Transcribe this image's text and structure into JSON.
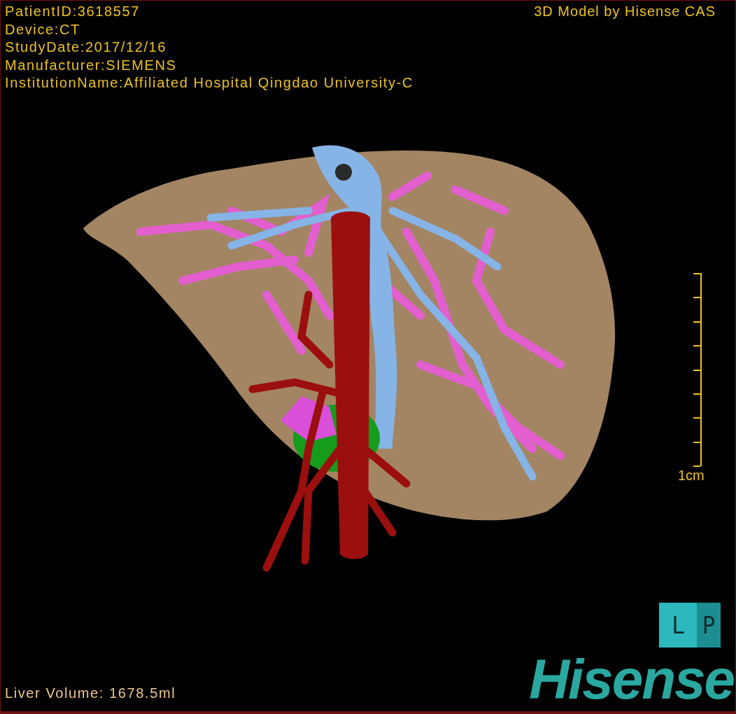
{
  "patient_info": [
    "PatientID:3618557",
    "Device:CT",
    "StudyDate:2017/12/16",
    "Manufacturer:SIEMENS",
    "InstitutionName:Affiliated Hospital Qingdao University-C"
  ],
  "credit": "3D Model by Hisense CAS",
  "scale_bar": {
    "label": "1cm"
  },
  "orientation_cube": {
    "faces": [
      "L",
      "P"
    ]
  },
  "logo": "Hisense",
  "liver_volume": "Liver Volume: 1678.5ml"
}
